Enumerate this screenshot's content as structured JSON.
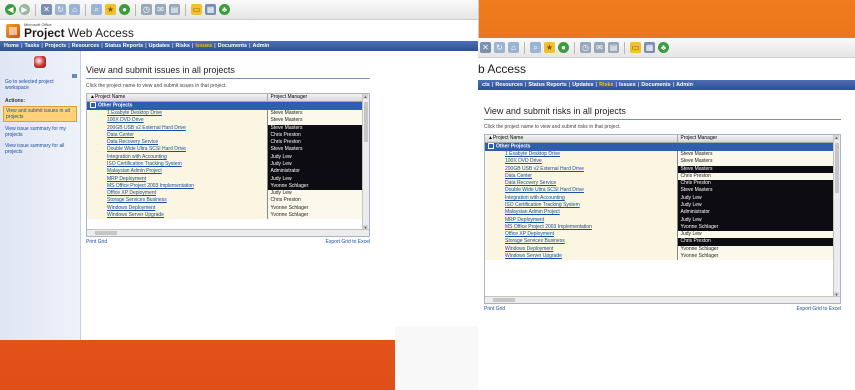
{
  "app": {
    "brand_small": "Microsoft Office",
    "brand_main": "Project",
    "brand_rest": " Web Access",
    "brand_right": "b Access"
  },
  "nav": {
    "left": [
      "Home",
      "Tasks",
      "Projects",
      "Resources",
      "Status Reports",
      "Updates",
      "Risks",
      "Issues",
      "Documents",
      "Admin"
    ],
    "left_active": "Issues",
    "right": [
      "cts",
      "Resources",
      "Status Reports",
      "Updates",
      "Risks",
      "Issues",
      "Documents",
      "Admin"
    ],
    "right_active": "Risks"
  },
  "sidebar": {
    "goto_link": "Go to selected project workspace",
    "actions_heading": "Actions:",
    "actions": [
      "View and submit issues in all projects",
      "View issue summary for my projects",
      "View issue summary for all projects"
    ]
  },
  "left_page": {
    "title": "View and submit issues in all projects",
    "subtitle": "Click the project name to view and submit issues in that project."
  },
  "right_page": {
    "title": "View and submit risks in all projects",
    "subtitle": "Click the project name to view and submit risks in that project."
  },
  "grid": {
    "col_project": "Project Name",
    "col_manager": "Project Manager",
    "group_label": "Other Projects",
    "print_label": "Print Grid",
    "export_label": "Export Grid to Excel"
  },
  "left_rows": [
    {
      "project": "1 Exabyte Desktop Drive",
      "manager": "Steve Masters",
      "style": "light"
    },
    {
      "project": "100X DVD Drive",
      "manager": "Steve Masters",
      "style": "light"
    },
    {
      "project": "200GB USB v2 External Hard Drive",
      "manager": "Steve Masters",
      "style": "dark"
    },
    {
      "project": "Data Center",
      "manager": "Chris Preston",
      "style": "dark"
    },
    {
      "project": "Data Recovery Service",
      "manager": "Chris Preston",
      "style": "dark"
    },
    {
      "project": "Double Wide Ultra SCSI Hard Drive",
      "manager": "Steve Masters",
      "style": "dark"
    },
    {
      "project": "Integration with Accounting",
      "manager": "Judy Lew",
      "style": "dark"
    },
    {
      "project": "ISO Certification Tracking System",
      "manager": "Judy Lew",
      "style": "dark"
    },
    {
      "project": "Malaysian Admin Project",
      "manager": "Administrator",
      "style": "dark"
    },
    {
      "project": "MRP Deployment",
      "manager": "Judy Lew",
      "style": "dark"
    },
    {
      "project": "MS Office Project 2003 Implementation",
      "manager": "Yvonne Schlager",
      "style": "dark"
    },
    {
      "project": "Office XP Deployment",
      "manager": "Judy Lew",
      "style": "light"
    },
    {
      "project": "Storage Services Business",
      "manager": "Chris Preston",
      "style": "light"
    },
    {
      "project": "Windows Deployment",
      "manager": "Yvonne Schlager",
      "style": "light"
    },
    {
      "project": "Windows Server Upgrade",
      "manager": "Yvonne Schlager",
      "style": "light"
    }
  ],
  "right_rows": [
    {
      "project": "1 Exabyte Desktop Drive",
      "manager": "Steve Masters",
      "style": "light"
    },
    {
      "project": "100X DVD Drive",
      "manager": "Steve Masters",
      "style": "light"
    },
    {
      "project": "200GB USB v2 External Hard Drive",
      "manager": "Steve Masters",
      "style": "dark"
    },
    {
      "project": "Data Center",
      "manager": "Chris Preston",
      "style": "light"
    },
    {
      "project": "Data Recovery Service",
      "manager": "Chris Preston",
      "style": "dark"
    },
    {
      "project": "Double Wide Ultra SCSI Hard Drive",
      "manager": "Steve Masters",
      "style": "dark"
    },
    {
      "project": "Integration with Accounting",
      "manager": "Judy Lew",
      "style": "dark"
    },
    {
      "project": "ISO Certification Tracking System",
      "manager": "Judy Lew",
      "style": "dark"
    },
    {
      "project": "Malaysian Admin Project",
      "manager": "Administrator",
      "style": "dark"
    },
    {
      "project": "MRP Deployment",
      "manager": "Judy Lew",
      "style": "dark"
    },
    {
      "project": "MS Office Project 2003 Implementation",
      "manager": "Yvonne Schlager",
      "style": "dark"
    },
    {
      "project": "Office XP Deployment",
      "manager": "Judy Lew",
      "style": "light"
    },
    {
      "project": "Storage Services Business",
      "manager": "Chris Preston",
      "style": "dark"
    },
    {
      "project": "Windows Deployment",
      "manager": "Yvonne Schlager",
      "style": "light"
    },
    {
      "project": "Windows Server Upgrade",
      "manager": "Yvonne Schlager",
      "style": "light"
    }
  ],
  "colors": {
    "background": "#e8641a",
    "navbar": "#2c4f96",
    "group_row": "#2f5db0",
    "link": "#1a4fa0",
    "active_nav": "#ffc400"
  }
}
